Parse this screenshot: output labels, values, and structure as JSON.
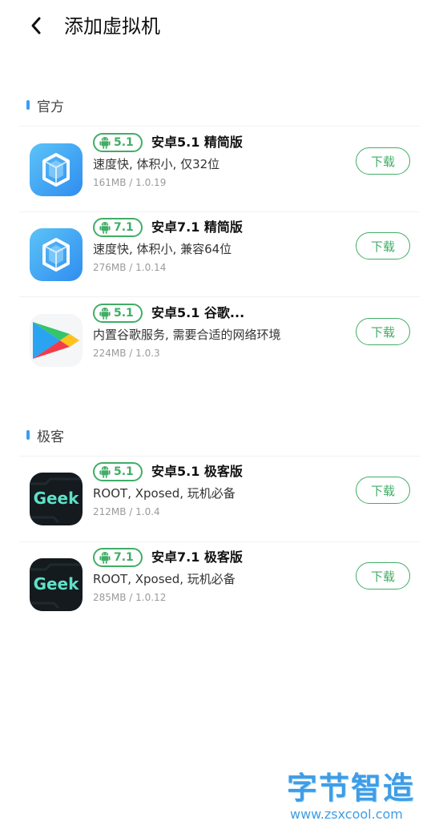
{
  "header": {
    "title": "添加虚拟机",
    "back_icon": "chevron-left-icon"
  },
  "sections": [
    {
      "title": "官方",
      "items": [
        {
          "icon": "vm-cube-icon",
          "version": "5.1",
          "name": "安卓5.1 精简版",
          "desc": "速度快, 体积小, 仅32位",
          "meta": "161MB / 1.0.19",
          "button": "下载"
        },
        {
          "icon": "vm-cube-icon",
          "version": "7.1",
          "name": "安卓7.1 精简版",
          "desc": "速度快, 体积小, 兼容64位",
          "meta": "276MB / 1.0.14",
          "button": "下载"
        },
        {
          "icon": "google-play-icon",
          "version": "5.1",
          "name": "安卓5.1 谷歌...",
          "desc": "内置谷歌服务, 需要合适的网络环境",
          "meta": "224MB / 1.0.3",
          "button": "下载"
        }
      ]
    },
    {
      "title": "极客",
      "items": [
        {
          "icon": "geek-icon",
          "icon_text": "Geek",
          "version": "5.1",
          "name": "安卓5.1 极客版",
          "desc": "ROOT, Xposed, 玩机必备",
          "meta": "212MB / 1.0.4",
          "button": "下载"
        },
        {
          "icon": "geek-icon",
          "icon_text": "Geek",
          "version": "7.1",
          "name": "安卓7.1 极客版",
          "desc": "ROOT, Xposed, 玩机必备",
          "meta": "285MB / 1.0.12",
          "button": "下载"
        }
      ]
    }
  ],
  "watermark": {
    "title": "字节智造",
    "url": "www.zsxcool.com"
  },
  "colors": {
    "accent": "#41ad66",
    "section_bar": "#3a9df4",
    "meta": "#9a9a9a",
    "watermark": "#3f9de6"
  }
}
